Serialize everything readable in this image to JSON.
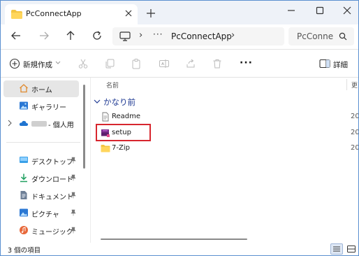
{
  "window": {
    "tab_title": "PcConnectApp",
    "colors": {
      "accent": "#d7262e",
      "selected": "#e6e6e6",
      "group_header": "#1f3a93"
    }
  },
  "address": {
    "ellipsis": "···",
    "crumb": "PcConnectApp"
  },
  "search": {
    "placeholder": "PcConne"
  },
  "toolbar": {
    "new_label": "新規作成",
    "more_label": "···",
    "details_label": "詳細",
    "icons": [
      "cut-icon",
      "copy-icon",
      "paste-icon",
      "rename-icon",
      "share-icon",
      "delete-icon"
    ]
  },
  "sidebar": {
    "home": "ホーム",
    "gallery": "ギャラリー",
    "onedrive": "- 個人用",
    "pinned": [
      {
        "label": "デスクトップ",
        "icon": "desktop-icon"
      },
      {
        "label": "ダウンロード",
        "icon": "download-icon"
      },
      {
        "label": "ドキュメント",
        "icon": "document-icon"
      },
      {
        "label": "ピクチャ",
        "icon": "picture-icon"
      },
      {
        "label": "ミュージック",
        "icon": "music-icon"
      }
    ]
  },
  "content": {
    "column_name": "名前",
    "column_date": "更",
    "group_label": "かなり前",
    "files": [
      {
        "name": "Readme",
        "date": "20",
        "icon": "text-file-icon"
      },
      {
        "name": "setup",
        "date": "20",
        "icon": "installer-icon"
      },
      {
        "name": "7-Zip",
        "date": "20",
        "icon": "folder-icon"
      }
    ]
  },
  "status": {
    "item_count": "3 個の項目"
  }
}
